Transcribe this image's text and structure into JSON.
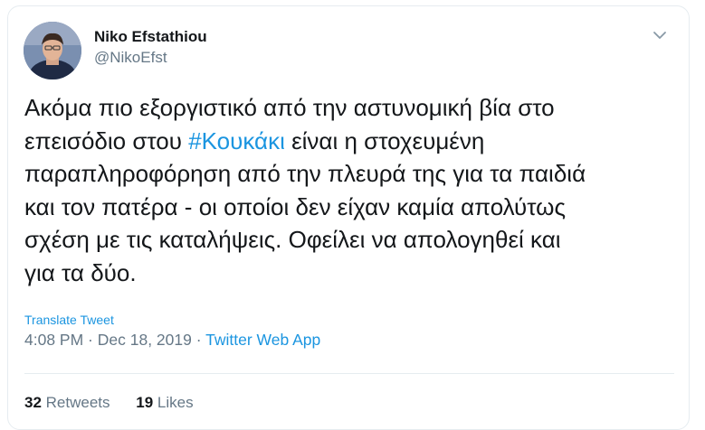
{
  "author": {
    "name": "Niko Efstathiou",
    "handle": "@NikoEfst"
  },
  "tweet": {
    "lines": [
      [
        "Ακόμα πιο εξοργιστικό από την αστυνομική βία στο"
      ],
      [
        "επεισόδιο στου ",
        "#Κουκάκι",
        " είναι η στοχευμένη"
      ],
      [
        "παραπληροφόρηση από την πλευρά της για τα παιδιά"
      ],
      [
        "και τον πατέρα - οι οποίοι δεν είχαν καμία απολύτως"
      ],
      [
        "σχέση με τις καταλήψεις. Οφείλει να απολογηθεί και"
      ],
      [
        "για τα δύο."
      ]
    ]
  },
  "translate_label": "Translate Tweet",
  "meta": {
    "time": "4:08 PM",
    "separator1": " · ",
    "date": "Dec 18, 2019",
    "separator2": " · ",
    "source": "Twitter Web App"
  },
  "stats": {
    "retweets_count": "32",
    "retweets_label": "Retweets",
    "likes_count": "19",
    "likes_label": "Likes"
  },
  "icons": {
    "caret": "chevron-down-icon",
    "avatar": "avatar"
  },
  "colors": {
    "accent": "#1b95e0",
    "text": "#14171a",
    "muted": "#657786",
    "border": "#e6ecf0"
  }
}
